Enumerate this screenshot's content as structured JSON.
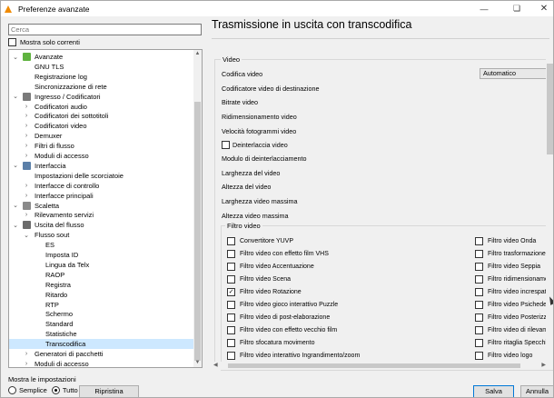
{
  "window": {
    "title": "Preferenze avanzate"
  },
  "search": {
    "placeholder": "Cerca"
  },
  "show_current": {
    "label": "Mostra solo correnti",
    "checked": false
  },
  "tree": [
    {
      "label": "Avanzate",
      "level": 1,
      "arrow": "open",
      "icon": "gear-icon",
      "color": "#5fb33f"
    },
    {
      "label": "GNU TLS",
      "level": 2,
      "arrow": ""
    },
    {
      "label": "Registrazione log",
      "level": 2,
      "arrow": ""
    },
    {
      "label": "Sincronizzazione di rete",
      "level": 2,
      "arrow": ""
    },
    {
      "label": "Ingresso / Codificatori",
      "level": 1,
      "arrow": "open",
      "icon": "input-icon",
      "color": "#7a7a7a"
    },
    {
      "label": "Codificatori audio",
      "level": 2,
      "arrow": "closed"
    },
    {
      "label": "Codificatori dei sottotitoli",
      "level": 2,
      "arrow": "closed"
    },
    {
      "label": "Codificatori video",
      "level": 2,
      "arrow": "closed"
    },
    {
      "label": "Demuxer",
      "level": 2,
      "arrow": "closed"
    },
    {
      "label": "Filtri di flusso",
      "level": 2,
      "arrow": "closed"
    },
    {
      "label": "Moduli di accesso",
      "level": 2,
      "arrow": "closed"
    },
    {
      "label": "Interfaccia",
      "level": 1,
      "arrow": "open",
      "icon": "interface-icon",
      "color": "#5b7fa8"
    },
    {
      "label": "Impostazioni delle scorciatoie",
      "level": 2,
      "arrow": ""
    },
    {
      "label": "Interfacce di controllo",
      "level": 2,
      "arrow": "closed"
    },
    {
      "label": "Interfacce principali",
      "level": 2,
      "arrow": "closed"
    },
    {
      "label": "Scaletta",
      "level": 1,
      "arrow": "open",
      "icon": "playlist-icon",
      "color": "#8a8a8a"
    },
    {
      "label": "Rilevamento servizi",
      "level": 2,
      "arrow": "closed"
    },
    {
      "label": "Uscita del flusso",
      "level": 1,
      "arrow": "open",
      "icon": "stream-output-icon",
      "color": "#6b6b6b"
    },
    {
      "label": "Flusso sout",
      "level": 2,
      "arrow": "open"
    },
    {
      "label": "ES",
      "level": 3,
      "arrow": ""
    },
    {
      "label": "Imposta ID",
      "level": 3,
      "arrow": ""
    },
    {
      "label": "Lingua da Telx",
      "level": 3,
      "arrow": ""
    },
    {
      "label": "RAOP",
      "level": 3,
      "arrow": ""
    },
    {
      "label": "Registra",
      "level": 3,
      "arrow": ""
    },
    {
      "label": "Ritardo",
      "level": 3,
      "arrow": ""
    },
    {
      "label": "RTP",
      "level": 3,
      "arrow": ""
    },
    {
      "label": "Schermo",
      "level": 3,
      "arrow": ""
    },
    {
      "label": "Standard",
      "level": 3,
      "arrow": ""
    },
    {
      "label": "Statistiche",
      "level": 3,
      "arrow": ""
    },
    {
      "label": "Transcodifica",
      "level": 3,
      "arrow": "",
      "selected": true
    },
    {
      "label": "Generatori di pacchetti",
      "level": 2,
      "arrow": "closed"
    },
    {
      "label": "Moduli di accesso",
      "level": 2,
      "arrow": "closed"
    }
  ],
  "panel": {
    "title": "Trasmissione in uscita con transcodifica",
    "group_video": "Video",
    "settings": [
      {
        "label": "Codifica video"
      },
      {
        "label": "Codificatore video di destinazione"
      },
      {
        "label": "Bitrate video"
      },
      {
        "label": "Ridimensionamento video"
      },
      {
        "label": "Velocità fotogrammi video"
      },
      {
        "label": "Deinterlaccia video",
        "checkbox": true
      },
      {
        "label": "Modulo di deinterlacciamento"
      },
      {
        "label": "Larghezza del video"
      },
      {
        "label": "Altezza del video"
      },
      {
        "label": "Larghezza video massima"
      },
      {
        "label": "Altezza video massima"
      }
    ],
    "codec_value": "Automatico",
    "filter_group": "Filtro video",
    "filters_left": [
      {
        "label": "Convertitore YUVP",
        "checked": false
      },
      {
        "label": "Filtro video con effetto film VHS",
        "checked": false
      },
      {
        "label": "Filtro video Accentuazione",
        "checked": false
      },
      {
        "label": "Filtro video Scena",
        "checked": false
      },
      {
        "label": "Filtro video Rotazione",
        "checked": true
      },
      {
        "label": "Filtro video gioco interattivo Puzzle",
        "checked": false
      },
      {
        "label": "Filtro video di post-elaborazione",
        "checked": false
      },
      {
        "label": "Filtro video con effetto vecchio film",
        "checked": false
      },
      {
        "label": "Filtro sfocatura movimento",
        "checked": false
      },
      {
        "label": "Filtro video interattivo Ingrandimento/zoom",
        "checked": false
      }
    ],
    "filters_right": [
      {
        "label": "Filtro video Onda",
        "checked": false
      },
      {
        "label": "Filtro trasformazione vid",
        "checked": false
      },
      {
        "label": "Filtro video Seppia",
        "checked": false
      },
      {
        "label": "Filtro ridimensionamento",
        "checked": false
      },
      {
        "label": "Filtro video increspatura",
        "checked": false
      },
      {
        "label": "Filtro video Psichedelica",
        "checked": false
      },
      {
        "label": "Filtro video Posterizza",
        "checked": false
      },
      {
        "label": "Filtro video di rilevament",
        "checked": false
      },
      {
        "label": "Filtro ritaglia Specchio",
        "checked": false
      },
      {
        "label": "Filtro video logo",
        "checked": false
      }
    ]
  },
  "footer": {
    "show_settings_label": "Mostra le impostazioni",
    "simple_label": "Semplice",
    "all_label": "Tutto",
    "selected_mode": "all",
    "reset_label": "Ripristina preferenze",
    "save_label": "Salva",
    "cancel_label": "Annulla"
  }
}
